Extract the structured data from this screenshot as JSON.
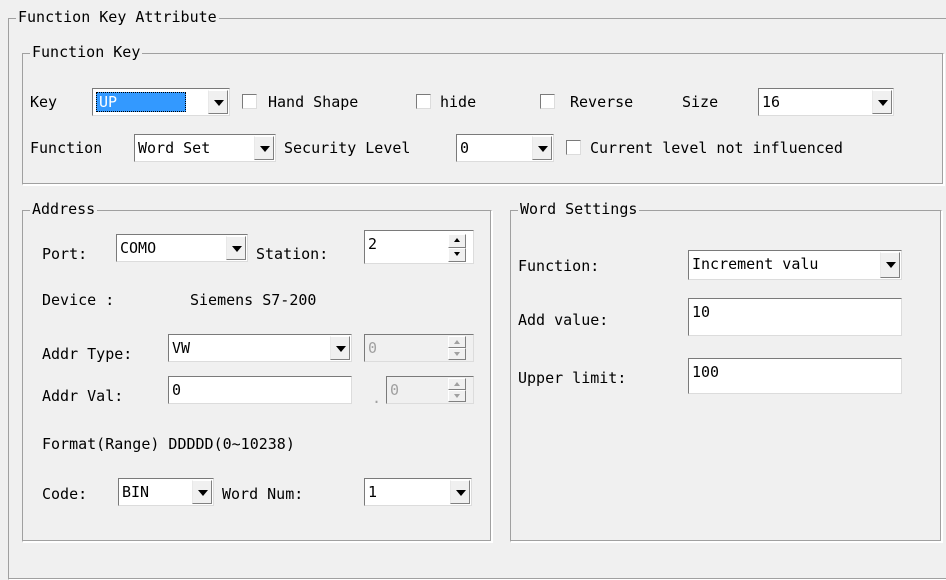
{
  "outer_group": {
    "title": "Function Key Attribute"
  },
  "function_key": {
    "title": "Function Key",
    "key_label": "Key",
    "key_value": "UP",
    "hand_shape_label": "Hand Shape",
    "hide_label": "hide",
    "reverse_label": "Reverse",
    "size_label": "Size",
    "size_value": "16",
    "function_label": "Function",
    "function_value": "Word Set",
    "security_label": "Security Level",
    "security_value": "0",
    "current_level_label": "Current level not influenced"
  },
  "address": {
    "title": "Address",
    "port_label": "Port:",
    "port_value": "COMO",
    "station_label": "Station:",
    "station_value": "2",
    "device_label": "Device :",
    "device_value": "Siemens S7-200",
    "addr_type_label": "Addr Type:",
    "addr_type_value": "VW",
    "addr_type_spin_value": "0",
    "addr_val_label": "Addr Val:",
    "addr_val_value": "0",
    "addr_val_dot": ".",
    "addr_val_spin_value": "0",
    "format_text": "Format(Range) DDDDD(0~10238)",
    "code_label": "Code:",
    "code_value": "BIN",
    "word_num_label": "Word Num:",
    "word_num_value": "1"
  },
  "word_settings": {
    "title": "Word Settings",
    "function_label": "Function:",
    "function_value": "Increment valu",
    "add_value_label": "Add value:",
    "add_value_value": "10",
    "upper_limit_label": "Upper limit:",
    "upper_limit_value": "100"
  }
}
